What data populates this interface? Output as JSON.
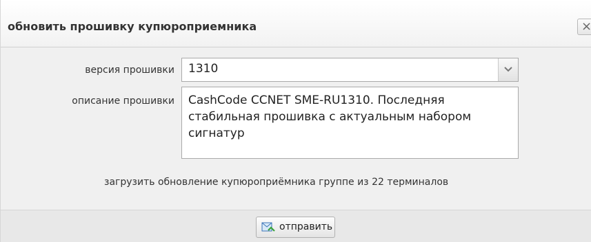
{
  "dialog": {
    "title": "обновить прошивку купюроприемника",
    "close_symbol": "×"
  },
  "form": {
    "version_label": "версия прошивки",
    "version_value": "1310",
    "description_label": "описание прошивки",
    "description_value": "CashCode CCNET SME-RU1310. Последняя стабильная прошивка с актуальным набором сигнатур"
  },
  "info_text": "загрузить обновление купюроприёмника группе из 22 терминалов",
  "footer": {
    "submit_label": "отправить"
  },
  "icons": {
    "close": "close-icon",
    "dropdown": "chevron-down-icon",
    "submit": "send-icon"
  }
}
